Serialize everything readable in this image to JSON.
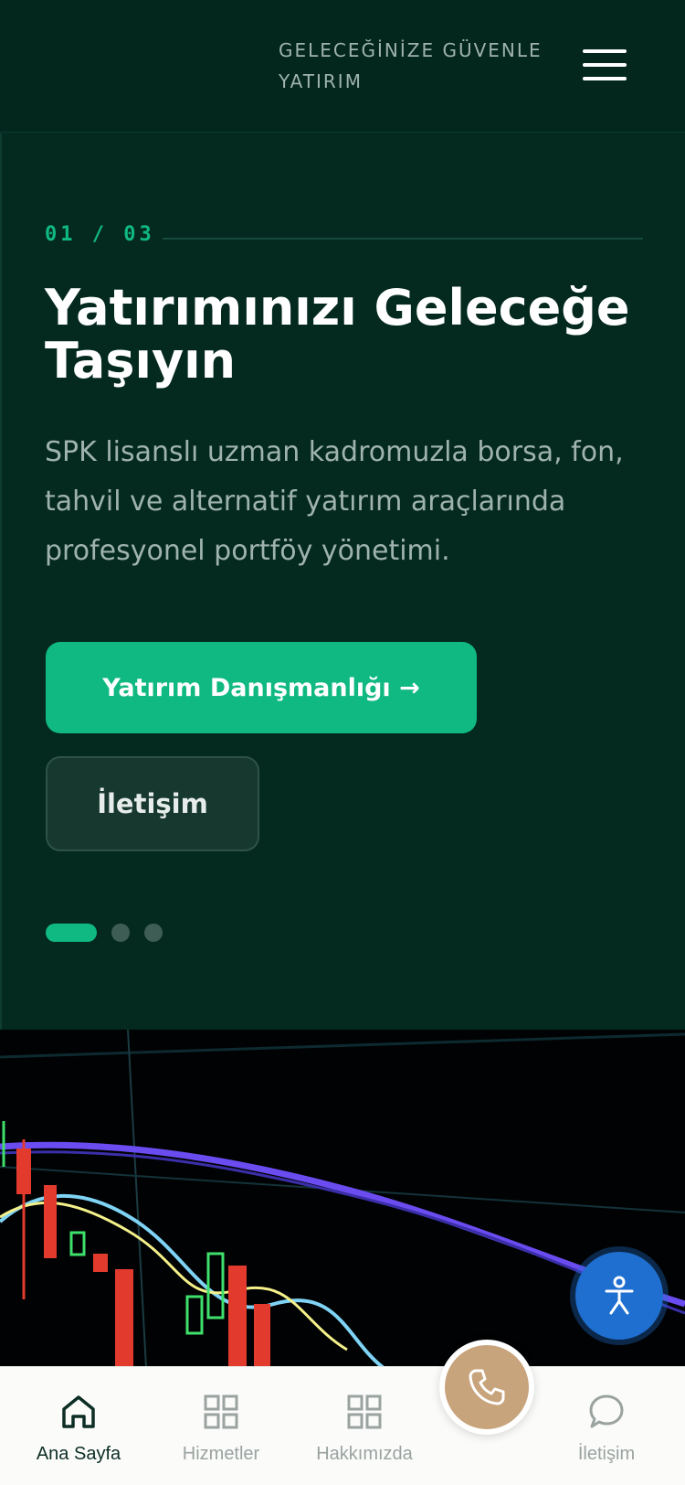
{
  "header": {
    "tagline": "GELECEĞİNİZE GÜVENLE YATIRIM",
    "menu_icon": "hamburger-icon"
  },
  "hero": {
    "counter": "01 / 03",
    "title": "Yatırımınızı Geleceğe Taşıyın",
    "description": "SPK lisanslı uzman kadromuzla borsa, fon, tahvil ve alternatif yatırım araçlarında profesyonel portföy yönetimi.",
    "primary_button": "Yatırım Danışmanlığı →",
    "secondary_button": "İletişim",
    "active_slide": 1,
    "slide_count": 3
  },
  "bottom_nav": {
    "items": [
      {
        "label": "Ana Sayfa",
        "icon": "home-icon",
        "active": true
      },
      {
        "label": "Hizmetler",
        "icon": "grid-icon",
        "active": false
      },
      {
        "label": "Hakkımızda",
        "icon": "grid-icon",
        "active": false
      },
      {
        "label": "İletişim",
        "icon": "chat-bubble-icon",
        "active": false
      }
    ],
    "call_icon": "phone-icon"
  },
  "floating": {
    "accessibility_icon": "accessibility-icon"
  },
  "colors": {
    "background": "#04291f",
    "accent": "#10b981",
    "call_button": "#c8a47c",
    "accessibility_button": "#1f6fd1"
  }
}
